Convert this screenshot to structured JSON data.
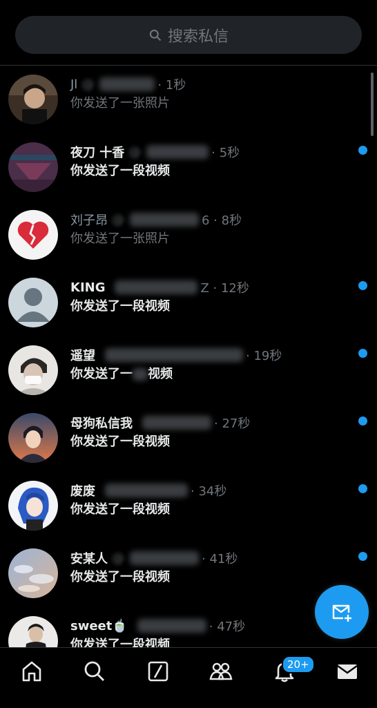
{
  "search": {
    "placeholder": "搜索私信"
  },
  "conversations": [
    {
      "name": "Jl",
      "handle": "@",
      "time": "· 1秒",
      "preview": "你发送了一张照片",
      "unread": false
    },
    {
      "name": "夜刀 十香",
      "handle": "@",
      "time": "· 5秒",
      "preview": "你发送了一段视频",
      "unread": true
    },
    {
      "name": "刘子昂",
      "handle": "@",
      "time": "6 · 8秒",
      "preview": "你发送了一张照片",
      "unread": false
    },
    {
      "name": "KING",
      "handle": "",
      "time": "Z · 12秒",
      "preview": "你发送了一段视频",
      "unread": true
    },
    {
      "name": "遥望",
      "handle": "",
      "time": "· 19秒",
      "preview": "你发送了一",
      "preview_tail": "视频",
      "unread": true
    },
    {
      "name": "母狗私信我",
      "handle": "",
      "time": "· 27秒",
      "preview": "你发送了一段视频",
      "unread": true
    },
    {
      "name": "废废",
      "handle": "",
      "time": "· 34秒",
      "preview": "你发送了一段视频",
      "unread": true
    },
    {
      "name": "安某人",
      "handle": "@",
      "time": "· 41秒",
      "preview": "你发送了一段视频",
      "unread": true
    },
    {
      "name": "sweet🍵",
      "handle": "",
      "time": "· 47秒",
      "preview": "你发送了一段视频",
      "unread": true
    }
  ],
  "notifications": {
    "badge": "20+"
  },
  "icons": {
    "search": "search-icon",
    "home": "home-icon",
    "explore": "search-tab-icon",
    "grok": "slash-square-icon",
    "communities": "people-icon",
    "notifications": "bell-icon",
    "messages": "envelope-icon",
    "compose": "new-message-icon"
  },
  "colors": {
    "accent": "#1d9bf0",
    "background": "#000000",
    "searchBg": "#202327"
  }
}
